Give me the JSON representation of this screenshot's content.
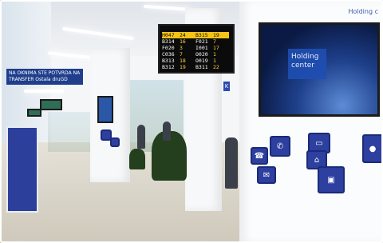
{
  "photo": {
    "banner_text": "NA OKNIMA STE POTVRDA NA TRANSFER Ostala druGD",
    "logo_text": "Holding c",
    "tv_text": "Holding center",
    "pillar_sign": "K",
    "queue_board": {
      "rows": [
        {
          "ticket": "H047",
          "counter": "24",
          "ticket2": "B315",
          "counter2": "19"
        },
        {
          "ticket": "B314",
          "counter": "16",
          "ticket2": "F021",
          "counter2": "7"
        },
        {
          "ticket": "F020",
          "counter": "3",
          "ticket2": "I001",
          "counter2": "17"
        },
        {
          "ticket": "C036",
          "counter": "7",
          "ticket2": "O020",
          "counter2": "1"
        },
        {
          "ticket": "B313",
          "counter": "18",
          "ticket2": "O019",
          "counter2": "1"
        },
        {
          "ticket": "B312",
          "counter": "19",
          "ticket2": "B311",
          "counter2": "22"
        }
      ]
    },
    "colors": {
      "brand_blue": "#2d3f9f",
      "board_yellow": "#f3c318",
      "wall": "#f7f8f9"
    }
  }
}
